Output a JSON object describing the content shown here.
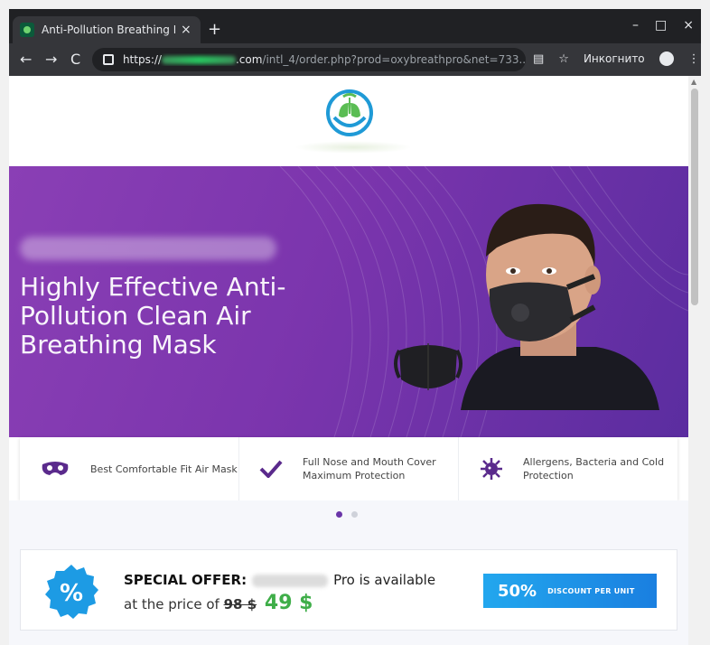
{
  "browser": {
    "tab_title": "Anti-Pollution Breathing M",
    "url_prefix": "https://",
    "url_host_tail": ".com",
    "url_path": "/intl_4/order.php?prod=oxybreathpro&net=733...",
    "incognito_label": "Инкогнито",
    "new_tab_symbol": "+",
    "tab_close_symbol": "×",
    "window_buttons": [
      "–",
      "□",
      "×"
    ],
    "nav": {
      "back": "←",
      "forward": "→",
      "reload": "C"
    },
    "more_symbol": "⋮",
    "star_symbol": "☆"
  },
  "hero": {
    "title": "Highly Effective Anti-Pollution Clean Air Breathing Mask",
    "accent_color": "#7b35ad"
  },
  "features": [
    {
      "icon": "mask-icon",
      "text": "Best Comfortable Fit Air Mask"
    },
    {
      "icon": "check-icon",
      "text": "Full Nose and Mouth Cover Maximum Protection"
    },
    {
      "icon": "virus-icon",
      "text": "Allergens, Bacteria and Cold Protection"
    }
  ],
  "slider": {
    "active_index": 0,
    "count": 2
  },
  "offer": {
    "label": "SPECIAL OFFER:",
    "availability_text": "Pro is available",
    "price_prefix": "at the price of",
    "old_price": "98 $",
    "new_price": "49 $",
    "badge_symbol": "%",
    "discount_percent": "50%",
    "discount_text": "DISCOUNT PER UNIT",
    "price_color": "#3fae49"
  }
}
